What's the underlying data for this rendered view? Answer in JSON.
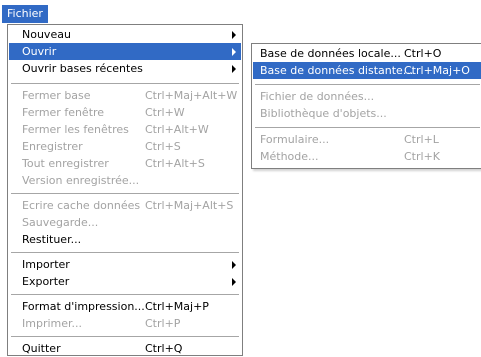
{
  "menubar": {
    "title": "Fichier"
  },
  "main_menu": {
    "items": [
      {
        "label": "Nouveau",
        "shortcut": "",
        "has_submenu": true
      },
      {
        "label": "Ouvrir",
        "shortcut": "",
        "has_submenu": true,
        "selected": true
      },
      {
        "label": "Ouvrir bases récentes",
        "shortcut": "",
        "has_submenu": true
      },
      {
        "label": "Fermer base",
        "shortcut": "Ctrl+Maj+Alt+W",
        "disabled": true
      },
      {
        "label": "Fermer fenêtre",
        "shortcut": "Ctrl+W",
        "disabled": true
      },
      {
        "label": "Fermer les fenêtres",
        "shortcut": "Ctrl+Alt+W",
        "disabled": true
      },
      {
        "label": "Enregistrer",
        "shortcut": "Ctrl+S",
        "disabled": true
      },
      {
        "label": "Tout enregistrer",
        "shortcut": "Ctrl+Alt+S",
        "disabled": true
      },
      {
        "label": "Version enregistrée...",
        "shortcut": "",
        "disabled": true
      },
      {
        "label": "Ecrire cache données",
        "shortcut": "Ctrl+Maj+Alt+S",
        "disabled": true
      },
      {
        "label": "Sauvegarde...",
        "shortcut": "",
        "disabled": true
      },
      {
        "label": "Restituer...",
        "shortcut": ""
      },
      {
        "label": "Importer",
        "shortcut": "",
        "has_submenu": true
      },
      {
        "label": "Exporter",
        "shortcut": "",
        "has_submenu": true
      },
      {
        "label": "Format d'impression...",
        "shortcut": "Ctrl+Maj+P"
      },
      {
        "label": "Imprimer...",
        "shortcut": "Ctrl+P",
        "disabled": true
      },
      {
        "label": "Quitter",
        "shortcut": "Ctrl+Q"
      }
    ]
  },
  "sub_menu": {
    "items": [
      {
        "label": "Base de données locale...",
        "shortcut": "Ctrl+O"
      },
      {
        "label": "Base de données distante...",
        "shortcut": "Ctrl+Maj+O",
        "selected": true
      },
      {
        "label": "Fichier de données...",
        "shortcut": "",
        "disabled": true
      },
      {
        "label": "Bibliothèque d'objets...",
        "shortcut": "",
        "disabled": true
      },
      {
        "label": "Formulaire...",
        "shortcut": "Ctrl+L",
        "disabled": true
      },
      {
        "label": "Méthode...",
        "shortcut": "Ctrl+K",
        "disabled": true
      }
    ]
  },
  "colors": {
    "highlight": "#316ac5",
    "disabled_text": "#a3a3a3",
    "separator": "#a6a6a6"
  }
}
